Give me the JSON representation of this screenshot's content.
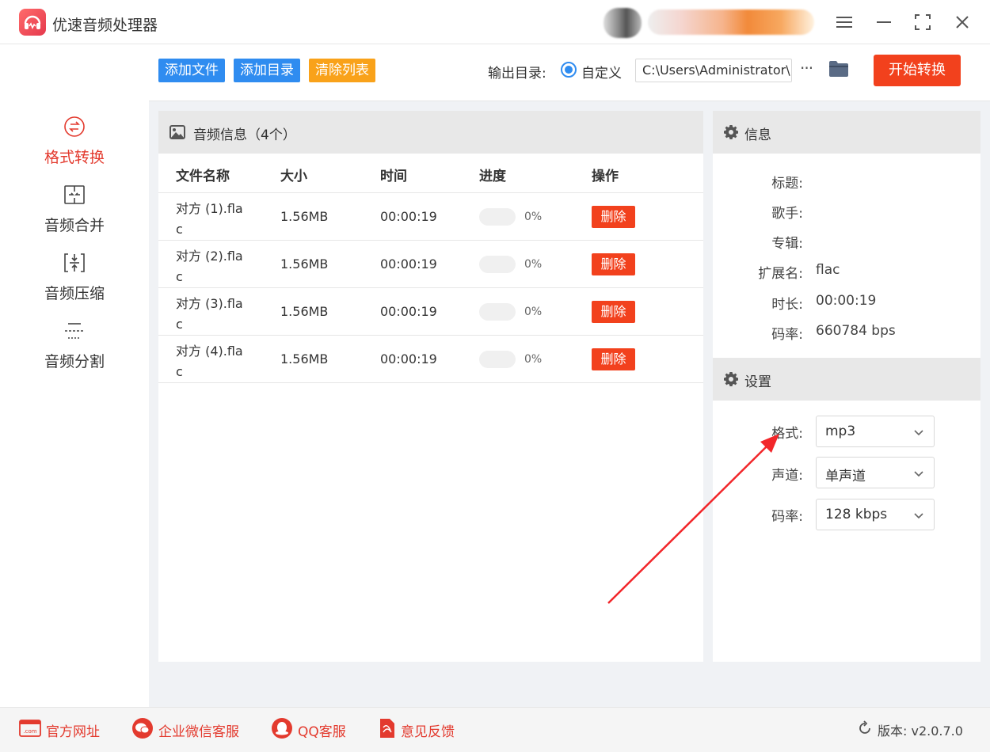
{
  "app": {
    "title": "优速音频处理器"
  },
  "window_controls": [
    "menu-icon",
    "minimize-icon",
    "maximize-icon",
    "close-icon"
  ],
  "sidebar": {
    "items": [
      {
        "label": "格式转换",
        "icon": "format-convert-icon",
        "active": true
      },
      {
        "label": "音频合并",
        "icon": "audio-merge-icon",
        "active": false
      },
      {
        "label": "音频压缩",
        "icon": "audio-compress-icon",
        "active": false
      },
      {
        "label": "音频分割",
        "icon": "audio-split-icon",
        "active": false
      }
    ]
  },
  "toolbar": {
    "add_file": "添加文件",
    "add_dir": "添加目录",
    "clear_list": "清除列表",
    "output_label": "输出目录:",
    "custom_label": "自定义",
    "output_path": "C:\\Users\\Administrator\\",
    "more": "···",
    "start": "开始转换"
  },
  "file_panel": {
    "title": "音频信息（4个）",
    "columns": [
      "文件名称",
      "大小",
      "时间",
      "进度",
      "操作"
    ],
    "rows": [
      {
        "name": "对方 (1).flac",
        "size": "1.56MB",
        "time": "00:00:19",
        "progress": "0%",
        "action": "删除"
      },
      {
        "name": "对方 (2).flac",
        "size": "1.56MB",
        "time": "00:00:19",
        "progress": "0%",
        "action": "删除"
      },
      {
        "name": "对方 (3).flac",
        "size": "1.56MB",
        "time": "00:00:19",
        "progress": "0%",
        "action": "删除"
      },
      {
        "name": "对方 (4).flac",
        "size": "1.56MB",
        "time": "00:00:19",
        "progress": "0%",
        "action": "删除"
      }
    ]
  },
  "info": {
    "title": "信息",
    "fields": [
      {
        "label": "标题:",
        "value": ""
      },
      {
        "label": "歌手:",
        "value": ""
      },
      {
        "label": "专辑:",
        "value": ""
      },
      {
        "label": "扩展名:",
        "value": "flac"
      },
      {
        "label": "时长:",
        "value": "00:00:19"
      },
      {
        "label": "码率:",
        "value": "660784 bps"
      }
    ]
  },
  "settings": {
    "title": "设置",
    "fields": [
      {
        "label": "格式:",
        "value": "mp3"
      },
      {
        "label": "声道:",
        "value": "单声道"
      },
      {
        "label": "码率:",
        "value": "128 kbps"
      }
    ]
  },
  "footer": {
    "website": "官方网址",
    "wechat": "企业微信客服",
    "qq": "QQ客服",
    "feedback": "意见反馈",
    "version": "版本: v2.0.7.0"
  },
  "colors": {
    "accent_red": "#e33a2e",
    "button_blue": "#2f8cf0",
    "button_orange": "#f9a21a",
    "start_red": "#f2411d"
  }
}
